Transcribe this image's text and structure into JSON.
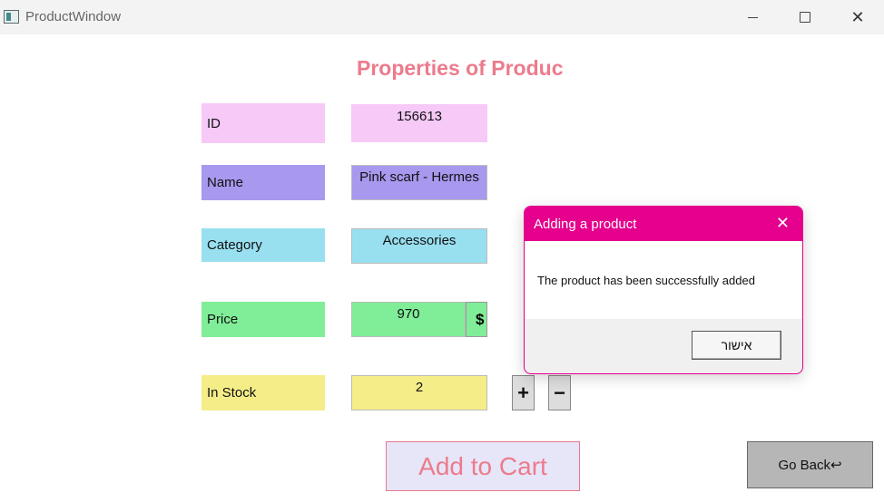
{
  "window": {
    "title": "ProductWindow",
    "min_icon": "minimize-icon",
    "max_icon": "maximize-icon",
    "close_glyph": "✕"
  },
  "page_title": "Properties of Produc",
  "fields": {
    "id": {
      "label": "ID",
      "value": "156613"
    },
    "name": {
      "label": "Name",
      "value": "Pink scarf - Hermes"
    },
    "category": {
      "label": "Category",
      "value": "Accessories"
    },
    "price": {
      "label": "Price",
      "value": "970",
      "currency": "$"
    },
    "stock": {
      "label": "In Stock",
      "value": "2",
      "plus": "+",
      "minus": "−"
    }
  },
  "buttons": {
    "add_to_cart": "Add to Cart",
    "go_back": "Go Back↩"
  },
  "dialog": {
    "title": "Adding a product",
    "close_glyph": "✕",
    "message": "The product has been successfully added",
    "ok_label": "אישור"
  },
  "colors": {
    "accent": "#e5008d",
    "title": "#ec7b8c",
    "id": "#f6c9f7",
    "name": "#a898ee",
    "category": "#98dff0",
    "price": "#80ee98",
    "stock": "#f5ed88"
  }
}
